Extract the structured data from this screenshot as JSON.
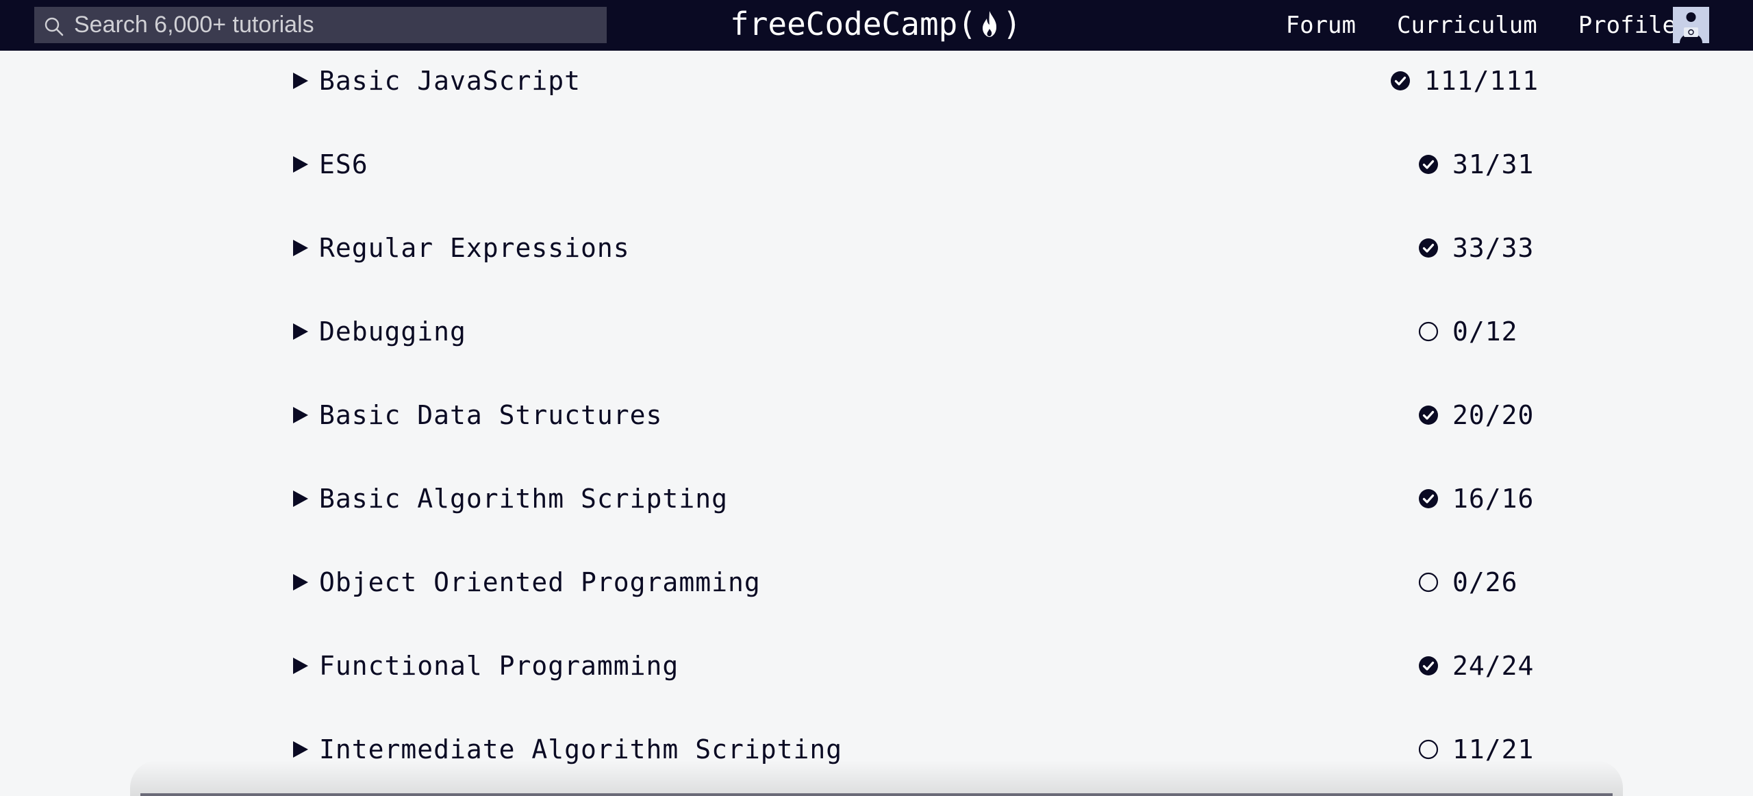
{
  "search": {
    "placeholder": "Search 6,000+ tutorials"
  },
  "brand": {
    "prefix": "freeCodeCamp(",
    "suffix": ")"
  },
  "nav": {
    "links": [
      "Forum",
      "Curriculum",
      "Profile"
    ]
  },
  "colors": {
    "nav_bg": "#0a0a23",
    "page_bg": "#f5f6f7",
    "text": "#0a0a23"
  },
  "sections": [
    {
      "title": "Basic JavaScript",
      "count": "111/111",
      "status": "complete"
    },
    {
      "title": "ES6",
      "count": "31/31",
      "status": "complete"
    },
    {
      "title": "Regular Expressions",
      "count": "33/33",
      "status": "complete"
    },
    {
      "title": "Debugging",
      "count": "0/12",
      "status": "incomplete"
    },
    {
      "title": "Basic Data Structures",
      "count": "20/20",
      "status": "complete"
    },
    {
      "title": "Basic Algorithm Scripting",
      "count": "16/16",
      "status": "complete"
    },
    {
      "title": "Object Oriented Programming",
      "count": "0/26",
      "status": "incomplete"
    },
    {
      "title": "Functional Programming",
      "count": "24/24",
      "status": "complete"
    },
    {
      "title": "Intermediate Algorithm Scripting",
      "count": "11/21",
      "status": "incomplete"
    }
  ]
}
